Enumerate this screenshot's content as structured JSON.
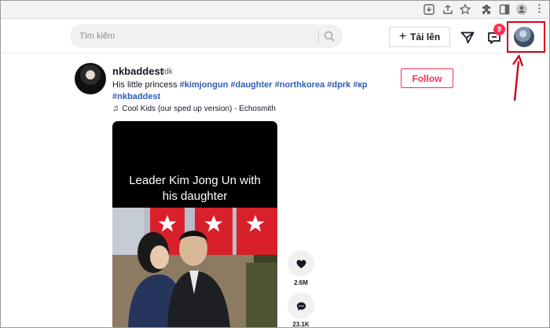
{
  "browser": {
    "icons": [
      "install-icon",
      "share-icon",
      "star-icon",
      "extensions-icon",
      "sidebar-icon",
      "profile-icon",
      "more-icon"
    ],
    "more_glyph": "⋮"
  },
  "header": {
    "search_placeholder": "Tìm kiếm",
    "upload_label": "Tải lên",
    "inbox_badge": "9"
  },
  "post": {
    "username": "nkbaddest",
    "nickname": "ldk",
    "caption_text": "His little princess ",
    "hashtags": [
      "#kimjongun",
      "#daughter",
      "#northkorea",
      "#dprk",
      "#кр",
      "#nkbaddest"
    ],
    "music": "Cool Kids (our sped up version) - Echosmith",
    "follow_label": "Follow",
    "video_title_line1": "Leader Kim Jong Un with",
    "video_title_line2": "his daughter",
    "like_count": "2.6M",
    "comment_count": "23.1K"
  },
  "colors": {
    "accent": "#fe2c55",
    "hashtag": "#2b5db9",
    "highlight": "#d0021b"
  }
}
